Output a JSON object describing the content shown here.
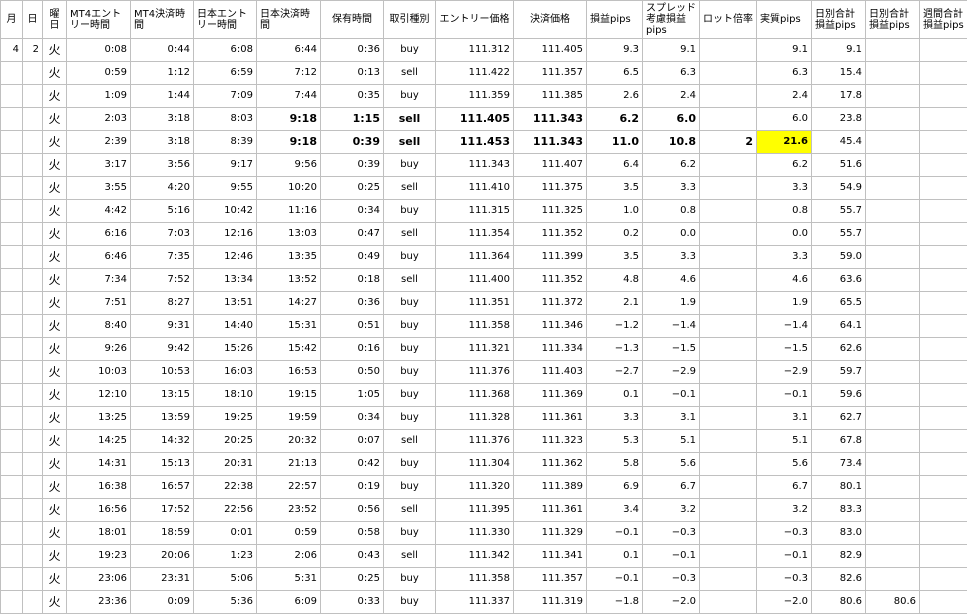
{
  "columns": [
    "月",
    "日",
    "曜日",
    "MT4エントリー時間",
    "MT4決済時間",
    "日本エントリー時間",
    "日本決済時間",
    "保有時間",
    "取引種別",
    "エントリー価格",
    "決済価格",
    "損益pips",
    "スプレッド考慮損益pips",
    "ロット倍率",
    "実質pips",
    "日別合計損益pips",
    "日別合計損益pips",
    "週間合計損益pips"
  ],
  "rows": [
    {
      "month": "4",
      "day": "2",
      "wd": "火",
      "mt4_in": "0:08",
      "mt4_out": "0:44",
      "jp_in": "6:08",
      "jp_out": "6:44",
      "hold": "0:36",
      "type": "buy",
      "entry": "111.312",
      "exit": "111.405",
      "pips": "9.3",
      "spread": "9.1",
      "lot": "",
      "real": "9.1",
      "daily": "9.1",
      "daily2": "",
      "weekly": ""
    },
    {
      "month": "",
      "day": "",
      "wd": "火",
      "mt4_in": "0:59",
      "mt4_out": "1:12",
      "jp_in": "6:59",
      "jp_out": "7:12",
      "hold": "0:13",
      "type": "sell",
      "entry": "111.422",
      "exit": "111.357",
      "pips": "6.5",
      "spread": "6.3",
      "lot": "",
      "real": "6.3",
      "daily": "15.4",
      "daily2": "",
      "weekly": ""
    },
    {
      "month": "",
      "day": "",
      "wd": "火",
      "mt4_in": "1:09",
      "mt4_out": "1:44",
      "jp_in": "7:09",
      "jp_out": "7:44",
      "hold": "0:35",
      "type": "buy",
      "entry": "111.359",
      "exit": "111.385",
      "pips": "2.6",
      "spread": "2.4",
      "lot": "",
      "real": "2.4",
      "daily": "17.8",
      "daily2": "",
      "weekly": ""
    },
    {
      "month": "",
      "day": "",
      "wd": "火",
      "mt4_in": "2:03",
      "mt4_out": "3:18",
      "jp_in": "8:03",
      "jp_out": "9:18",
      "hold": "1:15",
      "type": "sell",
      "entry": "111.405",
      "exit": "111.343",
      "pips": "6.2",
      "spread": "6.0",
      "lot": "",
      "real": "6.0",
      "daily": "23.8",
      "daily2": "",
      "weekly": ""
    },
    {
      "month": "",
      "day": "",
      "wd": "火",
      "mt4_in": "2:39",
      "mt4_out": "3:18",
      "jp_in": "8:39",
      "jp_out": "9:18",
      "hold": "0:39",
      "type": "sell",
      "entry": "111.453",
      "exit": "111.343",
      "pips": "11.0",
      "spread": "10.8",
      "lot": "2",
      "real": "21.6",
      "daily": "45.4",
      "daily2": "",
      "weekly": ""
    },
    {
      "month": "",
      "day": "",
      "wd": "火",
      "mt4_in": "3:17",
      "mt4_out": "3:56",
      "jp_in": "9:17",
      "jp_out": "9:56",
      "hold": "0:39",
      "type": "buy",
      "entry": "111.343",
      "exit": "111.407",
      "pips": "6.4",
      "spread": "6.2",
      "lot": "",
      "real": "6.2",
      "daily": "51.6",
      "daily2": "",
      "weekly": ""
    },
    {
      "month": "",
      "day": "",
      "wd": "火",
      "mt4_in": "3:55",
      "mt4_out": "4:20",
      "jp_in": "9:55",
      "jp_out": "10:20",
      "hold": "0:25",
      "type": "sell",
      "entry": "111.410",
      "exit": "111.375",
      "pips": "3.5",
      "spread": "3.3",
      "lot": "",
      "real": "3.3",
      "daily": "54.9",
      "daily2": "",
      "weekly": ""
    },
    {
      "month": "",
      "day": "",
      "wd": "火",
      "mt4_in": "4:42",
      "mt4_out": "5:16",
      "jp_in": "10:42",
      "jp_out": "11:16",
      "hold": "0:34",
      "type": "buy",
      "entry": "111.315",
      "exit": "111.325",
      "pips": "1.0",
      "spread": "0.8",
      "lot": "",
      "real": "0.8",
      "daily": "55.7",
      "daily2": "",
      "weekly": ""
    },
    {
      "month": "",
      "day": "",
      "wd": "火",
      "mt4_in": "6:16",
      "mt4_out": "7:03",
      "jp_in": "12:16",
      "jp_out": "13:03",
      "hold": "0:47",
      "type": "sell",
      "entry": "111.354",
      "exit": "111.352",
      "pips": "0.2",
      "spread": "0.0",
      "lot": "",
      "real": "0.0",
      "daily": "55.7",
      "daily2": "",
      "weekly": ""
    },
    {
      "month": "",
      "day": "",
      "wd": "火",
      "mt4_in": "6:46",
      "mt4_out": "7:35",
      "jp_in": "12:46",
      "jp_out": "13:35",
      "hold": "0:49",
      "type": "buy",
      "entry": "111.364",
      "exit": "111.399",
      "pips": "3.5",
      "spread": "3.3",
      "lot": "",
      "real": "3.3",
      "daily": "59.0",
      "daily2": "",
      "weekly": ""
    },
    {
      "month": "",
      "day": "",
      "wd": "火",
      "mt4_in": "7:34",
      "mt4_out": "7:52",
      "jp_in": "13:34",
      "jp_out": "13:52",
      "hold": "0:18",
      "type": "sell",
      "entry": "111.400",
      "exit": "111.352",
      "pips": "4.8",
      "spread": "4.6",
      "lot": "",
      "real": "4.6",
      "daily": "63.6",
      "daily2": "",
      "weekly": ""
    },
    {
      "month": "",
      "day": "",
      "wd": "火",
      "mt4_in": "7:51",
      "mt4_out": "8:27",
      "jp_in": "13:51",
      "jp_out": "14:27",
      "hold": "0:36",
      "type": "buy",
      "entry": "111.351",
      "exit": "111.372",
      "pips": "2.1",
      "spread": "1.9",
      "lot": "",
      "real": "1.9",
      "daily": "65.5",
      "daily2": "",
      "weekly": ""
    },
    {
      "month": "",
      "day": "",
      "wd": "火",
      "mt4_in": "8:40",
      "mt4_out": "9:31",
      "jp_in": "14:40",
      "jp_out": "15:31",
      "hold": "0:51",
      "type": "buy",
      "entry": "111.358",
      "exit": "111.346",
      "pips": "−1.2",
      "spread": "−1.4",
      "lot": "",
      "real": "−1.4",
      "daily": "64.1",
      "daily2": "",
      "weekly": ""
    },
    {
      "month": "",
      "day": "",
      "wd": "火",
      "mt4_in": "9:26",
      "mt4_out": "9:42",
      "jp_in": "15:26",
      "jp_out": "15:42",
      "hold": "0:16",
      "type": "buy",
      "entry": "111.321",
      "exit": "111.334",
      "pips": "−1.3",
      "spread": "−1.5",
      "lot": "",
      "real": "−1.5",
      "daily": "62.6",
      "daily2": "",
      "weekly": ""
    },
    {
      "month": "",
      "day": "",
      "wd": "火",
      "mt4_in": "10:03",
      "mt4_out": "10:53",
      "jp_in": "16:03",
      "jp_out": "16:53",
      "hold": "0:50",
      "type": "buy",
      "entry": "111.376",
      "exit": "111.403",
      "pips": "−2.7",
      "spread": "−2.9",
      "lot": "",
      "real": "−2.9",
      "daily": "59.7",
      "daily2": "",
      "weekly": ""
    },
    {
      "month": "",
      "day": "",
      "wd": "火",
      "mt4_in": "12:10",
      "mt4_out": "13:15",
      "jp_in": "18:10",
      "jp_out": "19:15",
      "hold": "1:05",
      "type": "buy",
      "entry": "111.368",
      "exit": "111.369",
      "pips": "0.1",
      "spread": "−0.1",
      "lot": "",
      "real": "−0.1",
      "daily": "59.6",
      "daily2": "",
      "weekly": ""
    },
    {
      "month": "",
      "day": "",
      "wd": "火",
      "mt4_in": "13:25",
      "mt4_out": "13:59",
      "jp_in": "19:25",
      "jp_out": "19:59",
      "hold": "0:34",
      "type": "buy",
      "entry": "111.328",
      "exit": "111.361",
      "pips": "3.3",
      "spread": "3.1",
      "lot": "",
      "real": "3.1",
      "daily": "62.7",
      "daily2": "",
      "weekly": ""
    },
    {
      "month": "",
      "day": "",
      "wd": "火",
      "mt4_in": "14:25",
      "mt4_out": "14:32",
      "jp_in": "20:25",
      "jp_out": "20:32",
      "hold": "0:07",
      "type": "sell",
      "entry": "111.376",
      "exit": "111.323",
      "pips": "5.3",
      "spread": "5.1",
      "lot": "",
      "real": "5.1",
      "daily": "67.8",
      "daily2": "",
      "weekly": ""
    },
    {
      "month": "",
      "day": "",
      "wd": "火",
      "mt4_in": "14:31",
      "mt4_out": "15:13",
      "jp_in": "20:31",
      "jp_out": "21:13",
      "hold": "0:42",
      "type": "buy",
      "entry": "111.304",
      "exit": "111.362",
      "pips": "5.8",
      "spread": "5.6",
      "lot": "",
      "real": "5.6",
      "daily": "73.4",
      "daily2": "",
      "weekly": ""
    },
    {
      "month": "",
      "day": "",
      "wd": "火",
      "mt4_in": "16:38",
      "mt4_out": "16:57",
      "jp_in": "22:38",
      "jp_out": "22:57",
      "hold": "0:19",
      "type": "buy",
      "entry": "111.320",
      "exit": "111.389",
      "pips": "6.9",
      "spread": "6.7",
      "lot": "",
      "real": "6.7",
      "daily": "80.1",
      "daily2": "",
      "weekly": ""
    },
    {
      "month": "",
      "day": "",
      "wd": "火",
      "mt4_in": "16:56",
      "mt4_out": "17:52",
      "jp_in": "22:56",
      "jp_out": "23:52",
      "hold": "0:56",
      "type": "sell",
      "entry": "111.395",
      "exit": "111.361",
      "pips": "3.4",
      "spread": "3.2",
      "lot": "",
      "real": "3.2",
      "daily": "83.3",
      "daily2": "",
      "weekly": ""
    },
    {
      "month": "",
      "day": "",
      "wd": "火",
      "mt4_in": "18:01",
      "mt4_out": "18:59",
      "jp_in": "0:01",
      "jp_out": "0:59",
      "hold": "0:58",
      "type": "buy",
      "entry": "111.330",
      "exit": "111.329",
      "pips": "−0.1",
      "spread": "−0.3",
      "lot": "",
      "real": "−0.3",
      "daily": "83.0",
      "daily2": "",
      "weekly": ""
    },
    {
      "month": "",
      "day": "",
      "wd": "火",
      "mt4_in": "19:23",
      "mt4_out": "20:06",
      "jp_in": "1:23",
      "jp_out": "2:06",
      "hold": "0:43",
      "type": "sell",
      "entry": "111.342",
      "exit": "111.341",
      "pips": "0.1",
      "spread": "−0.1",
      "lot": "",
      "real": "−0.1",
      "daily": "82.9",
      "daily2": "",
      "weekly": ""
    },
    {
      "month": "",
      "day": "",
      "wd": "火",
      "mt4_in": "23:06",
      "mt4_out": "23:31",
      "jp_in": "5:06",
      "jp_out": "5:31",
      "hold": "0:25",
      "type": "buy",
      "entry": "111.358",
      "exit": "111.357",
      "pips": "−0.1",
      "spread": "−0.3",
      "lot": "",
      "real": "−0.3",
      "daily": "82.6",
      "daily2": "",
      "weekly": ""
    },
    {
      "month": "",
      "day": "",
      "wd": "火",
      "mt4_in": "23:36",
      "mt4_out": "0:09",
      "jp_in": "5:36",
      "jp_out": "6:09",
      "hold": "0:33",
      "type": "buy",
      "entry": "111.337",
      "exit": "111.319",
      "pips": "−1.8",
      "spread": "−2.0",
      "lot": "",
      "real": "−2.0",
      "daily": "80.6",
      "daily2": "80.6",
      "weekly": ""
    }
  ],
  "colors": {
    "highlight": "#ffff00",
    "gridline": "#c0c0c0"
  }
}
